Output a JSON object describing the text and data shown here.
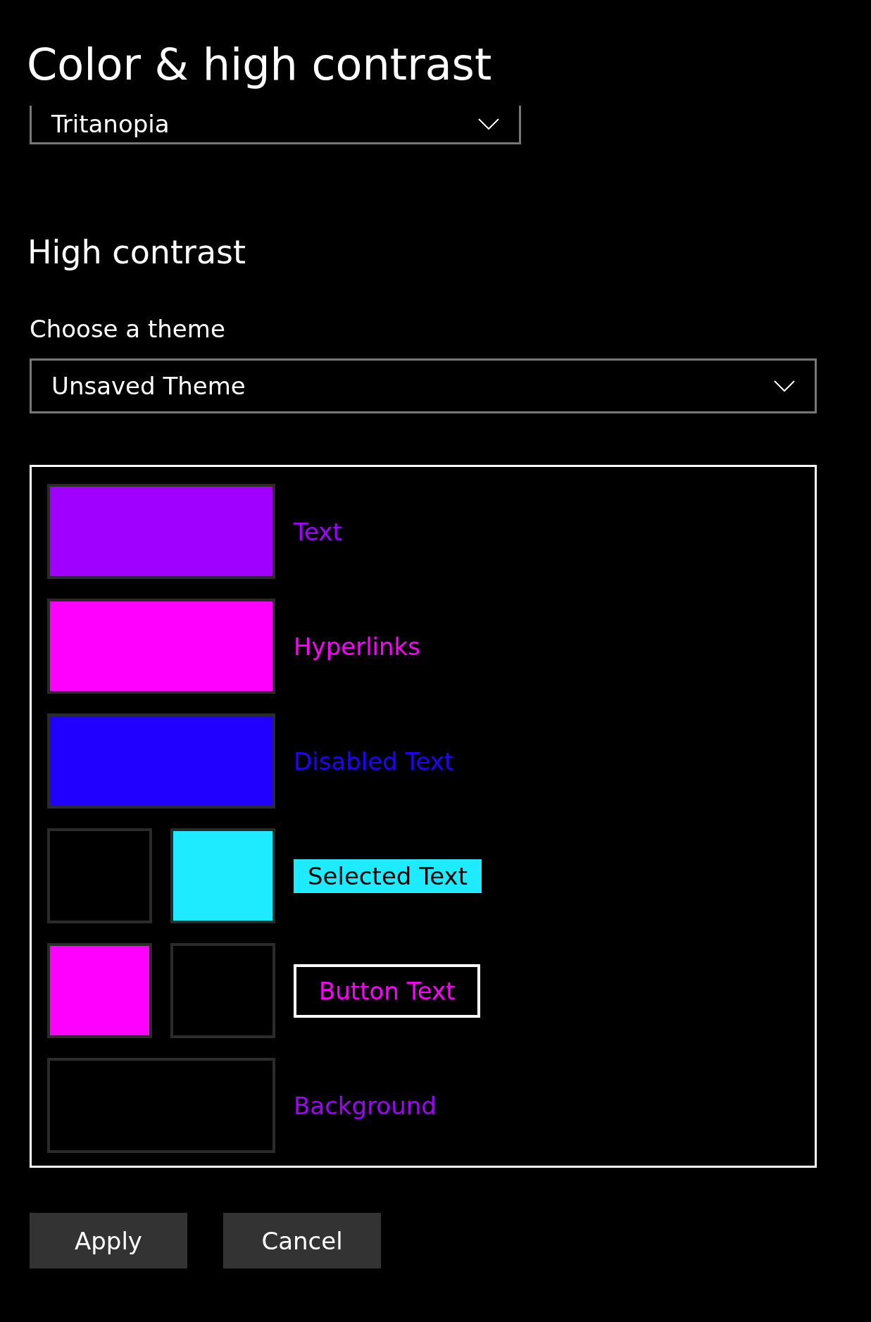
{
  "page": {
    "title": "Color & high contrast"
  },
  "color_filter": {
    "value": "Tritanopia"
  },
  "high_contrast": {
    "heading": "High contrast",
    "theme_label": "Choose a theme",
    "theme_value": "Unsaved Theme",
    "rows": [
      {
        "kind": "single",
        "label": "Text",
        "color": "#a000ff",
        "swatches": [
          {
            "color": "#a000ff"
          }
        ]
      },
      {
        "kind": "single",
        "label": "Hyperlinks",
        "color": "#ff00ff",
        "swatches": [
          {
            "color": "#ff00ff"
          }
        ]
      },
      {
        "kind": "single",
        "label": "Disabled Text",
        "color": "#2200ff",
        "swatches": [
          {
            "color": "#2200ff"
          }
        ]
      },
      {
        "kind": "highlight",
        "label": "Selected Text",
        "swatches": [
          {
            "color": "#000000"
          },
          {
            "color": "#1eebff"
          }
        ]
      },
      {
        "kind": "button",
        "label": "Button Text",
        "swatches": [
          {
            "color": "#ff00ff"
          },
          {
            "color": "#000000"
          }
        ]
      },
      {
        "kind": "background",
        "label": "Background",
        "color": "#a000ff",
        "swatches": [
          {
            "color": "#000000"
          }
        ]
      }
    ]
  },
  "buttons": [
    "Apply",
    "Cancel"
  ]
}
